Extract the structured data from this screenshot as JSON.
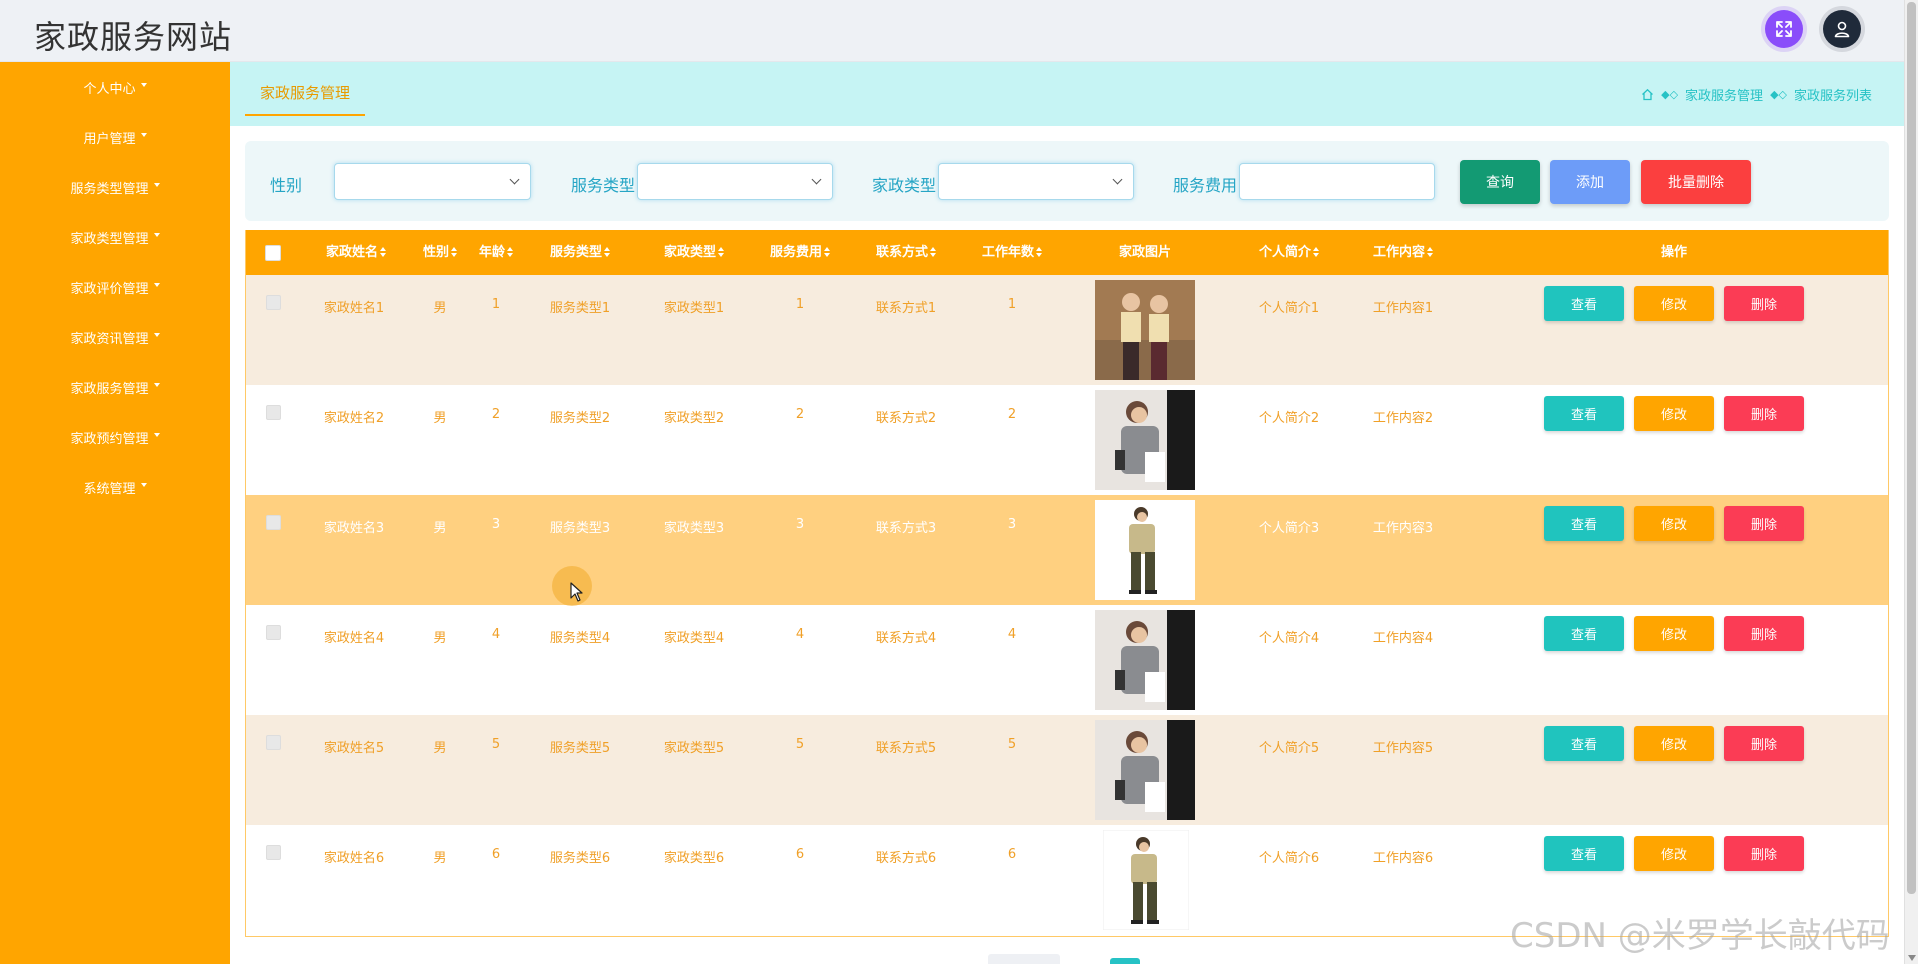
{
  "header": {
    "title": "家政服务网站"
  },
  "sidebar": {
    "items": [
      {
        "label": "个人中心"
      },
      {
        "label": "用户管理"
      },
      {
        "label": "服务类型管理"
      },
      {
        "label": "家政类型管理"
      },
      {
        "label": "家政评价管理"
      },
      {
        "label": "家政资讯管理"
      },
      {
        "label": "家政服务管理"
      },
      {
        "label": "家政预约管理"
      },
      {
        "label": "系统管理"
      }
    ]
  },
  "tab": {
    "label": "家政服务管理"
  },
  "breadcrumb": {
    "level1": "家政服务管理",
    "level2": "家政服务列表"
  },
  "search": {
    "gender_label": "性别",
    "gender_value": "",
    "service_type_label": "服务类型",
    "service_type_value": "",
    "housekeeping_type_label": "家政类型",
    "housekeeping_type_value": "",
    "fee_label": "服务费用",
    "fee_value": "",
    "query_button": "查询",
    "add_button": "添加",
    "batch_delete_button": "批量删除"
  },
  "table": {
    "columns": [
      "家政姓名",
      "性别",
      "年龄",
      "服务类型",
      "家政类型",
      "服务费用",
      "联系方式",
      "工作年数",
      "家政图片",
      "个人简介",
      "工作内容",
      "操作"
    ],
    "rows": [
      {
        "name": "家政姓名1",
        "gender": "男",
        "age": "1",
        "service_type": "服务类型1",
        "hk_type": "家政类型1",
        "fee": "1",
        "contact": "联系方式1",
        "years": "1",
        "intro": "个人简介1",
        "content": "工作内容1"
      },
      {
        "name": "家政姓名2",
        "gender": "男",
        "age": "2",
        "service_type": "服务类型2",
        "hk_type": "家政类型2",
        "fee": "2",
        "contact": "联系方式2",
        "years": "2",
        "intro": "个人简介2",
        "content": "工作内容2"
      },
      {
        "name": "家政姓名3",
        "gender": "男",
        "age": "3",
        "service_type": "服务类型3",
        "hk_type": "家政类型3",
        "fee": "3",
        "contact": "联系方式3",
        "years": "3",
        "intro": "个人简介3",
        "content": "工作内容3"
      },
      {
        "name": "家政姓名4",
        "gender": "男",
        "age": "4",
        "service_type": "服务类型4",
        "hk_type": "家政类型4",
        "fee": "4",
        "contact": "联系方式4",
        "years": "4",
        "intro": "个人简介4",
        "content": "工作内容4"
      },
      {
        "name": "家政姓名5",
        "gender": "男",
        "age": "5",
        "service_type": "服务类型5",
        "hk_type": "家政类型5",
        "fee": "5",
        "contact": "联系方式5",
        "years": "5",
        "intro": "个人简介5",
        "content": "工作内容5"
      },
      {
        "name": "家政姓名6",
        "gender": "男",
        "age": "6",
        "service_type": "服务类型6",
        "hk_type": "家政类型6",
        "fee": "6",
        "contact": "联系方式6",
        "years": "6",
        "intro": "个人简介6",
        "content": "工作内容6"
      }
    ],
    "actions": {
      "view": "查看",
      "edit": "修改",
      "delete": "删除"
    }
  },
  "watermark": "CSDN @米罗学长敲代码",
  "colors": {
    "sidebar": "#ffa500",
    "accent": "#26c2c5",
    "table_header": "#ffa500",
    "row_alt": "#f7ecde",
    "row_hover": "#ffd080",
    "cell_text": "#f0a028",
    "view_button": "#20c4be",
    "edit_button": "#ffa500",
    "delete_button": "#fb3c55",
    "query_button": "#139a73",
    "add_button": "#6d9cf8",
    "batch_delete_button": "#fb3f3f"
  },
  "icons": [
    "fullscreen-icon",
    "user-icon",
    "home-icon",
    "breadcrumb-separator-icon",
    "chevron-down-icon",
    "sort-icon",
    "mouse-cursor-icon"
  ]
}
